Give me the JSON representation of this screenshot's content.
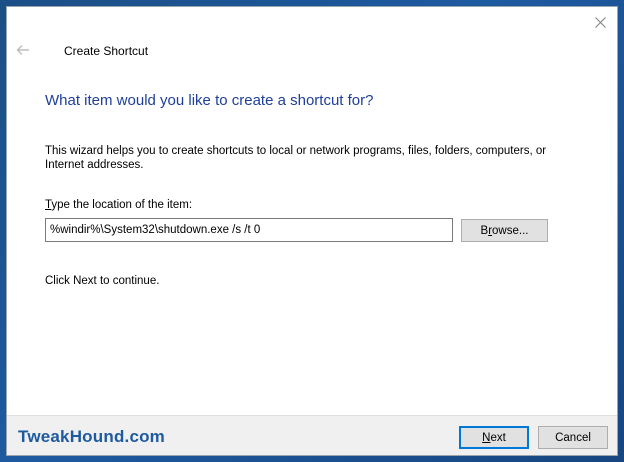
{
  "window": {
    "title": "Create Shortcut",
    "back_icon": "back-arrow-icon",
    "close_icon": "close-icon"
  },
  "content": {
    "heading": "What item would you like to create a shortcut for?",
    "description": "This wizard helps you to create shortcuts to local or network programs, files, folders, computers, or Internet addresses.",
    "field_label_mnemonic": "T",
    "field_label_rest": "ype the location of the item:",
    "location_value": "%windir%\\System32\\shutdown.exe /s /t 0",
    "browse_mnemonic": "r",
    "browse_prefix": "B",
    "browse_rest": "owse...",
    "continue_text": "Click Next to continue."
  },
  "footer": {
    "watermark": "TweakHound.com",
    "next_mnemonic": "N",
    "next_rest": "ext",
    "cancel_label": "Cancel"
  },
  "colors": {
    "heading": "#1e3f9a",
    "watermark": "#1e5aa0",
    "accent": "#0078d7",
    "desktop": "#1e5aa0"
  }
}
